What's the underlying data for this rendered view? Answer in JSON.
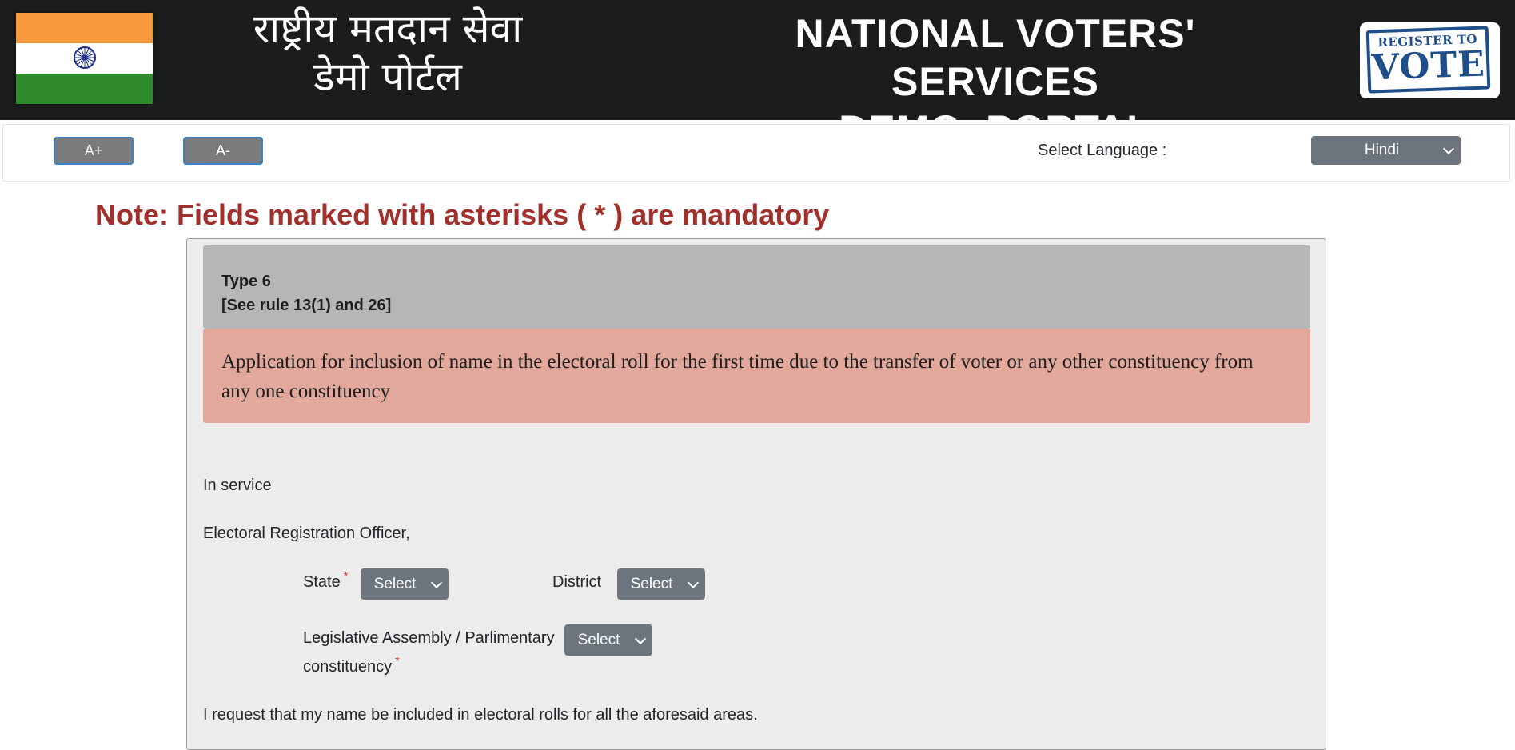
{
  "header": {
    "flag_icon": "india-flag",
    "hindi_title_line1": "राष्ट्रीय मतदान सेवा",
    "hindi_title_line2": "डेमो पोर्टल",
    "english_title_line1": "NATIONAL VOTERS' SERVICES",
    "english_title_line2": "DEMO  PORTAL",
    "logo_icon": "register-to-vote-logo",
    "logo_text_top": "REGISTER TO",
    "logo_text_main": "VOTE"
  },
  "toolbar": {
    "increase_font_label": "A+",
    "decrease_font_label": "A-",
    "language_label": "Select Language :",
    "language_selected": "Hindi"
  },
  "note": "Note: Fields marked with asterisks ( * ) are mandatory",
  "form": {
    "type_title": "Type 6",
    "type_rule": "[See rule 13(1) and 26]",
    "application_title": "Application for inclusion of name in the electoral roll for the first time due to the transfer of voter or any other constituency from any one constituency",
    "in_service": "In service",
    "ero": "Electoral Registration Officer,",
    "state_label": "State",
    "state_value": "Select",
    "district_label": "District",
    "district_value": "Select",
    "constituency_label_line1": "Legislative Assembly / Parlimentary",
    "constituency_label_line2": "constituency",
    "constituency_value": "Select",
    "required_marker": "*",
    "request_text": "I request that my name be included in electoral rolls for all the aforesaid areas."
  },
  "colors": {
    "header_bg": "#1b1c1e",
    "note_red": "#a12f2b",
    "form_bg": "#ececec",
    "type_box_bg": "#b6b6b6",
    "application_box_bg": "#e1a89b",
    "select_bg": "#6c757d",
    "font_button_bg": "#7a7b7d",
    "font_button_border": "#3f7fc4",
    "required_red": "#e02b2b"
  }
}
